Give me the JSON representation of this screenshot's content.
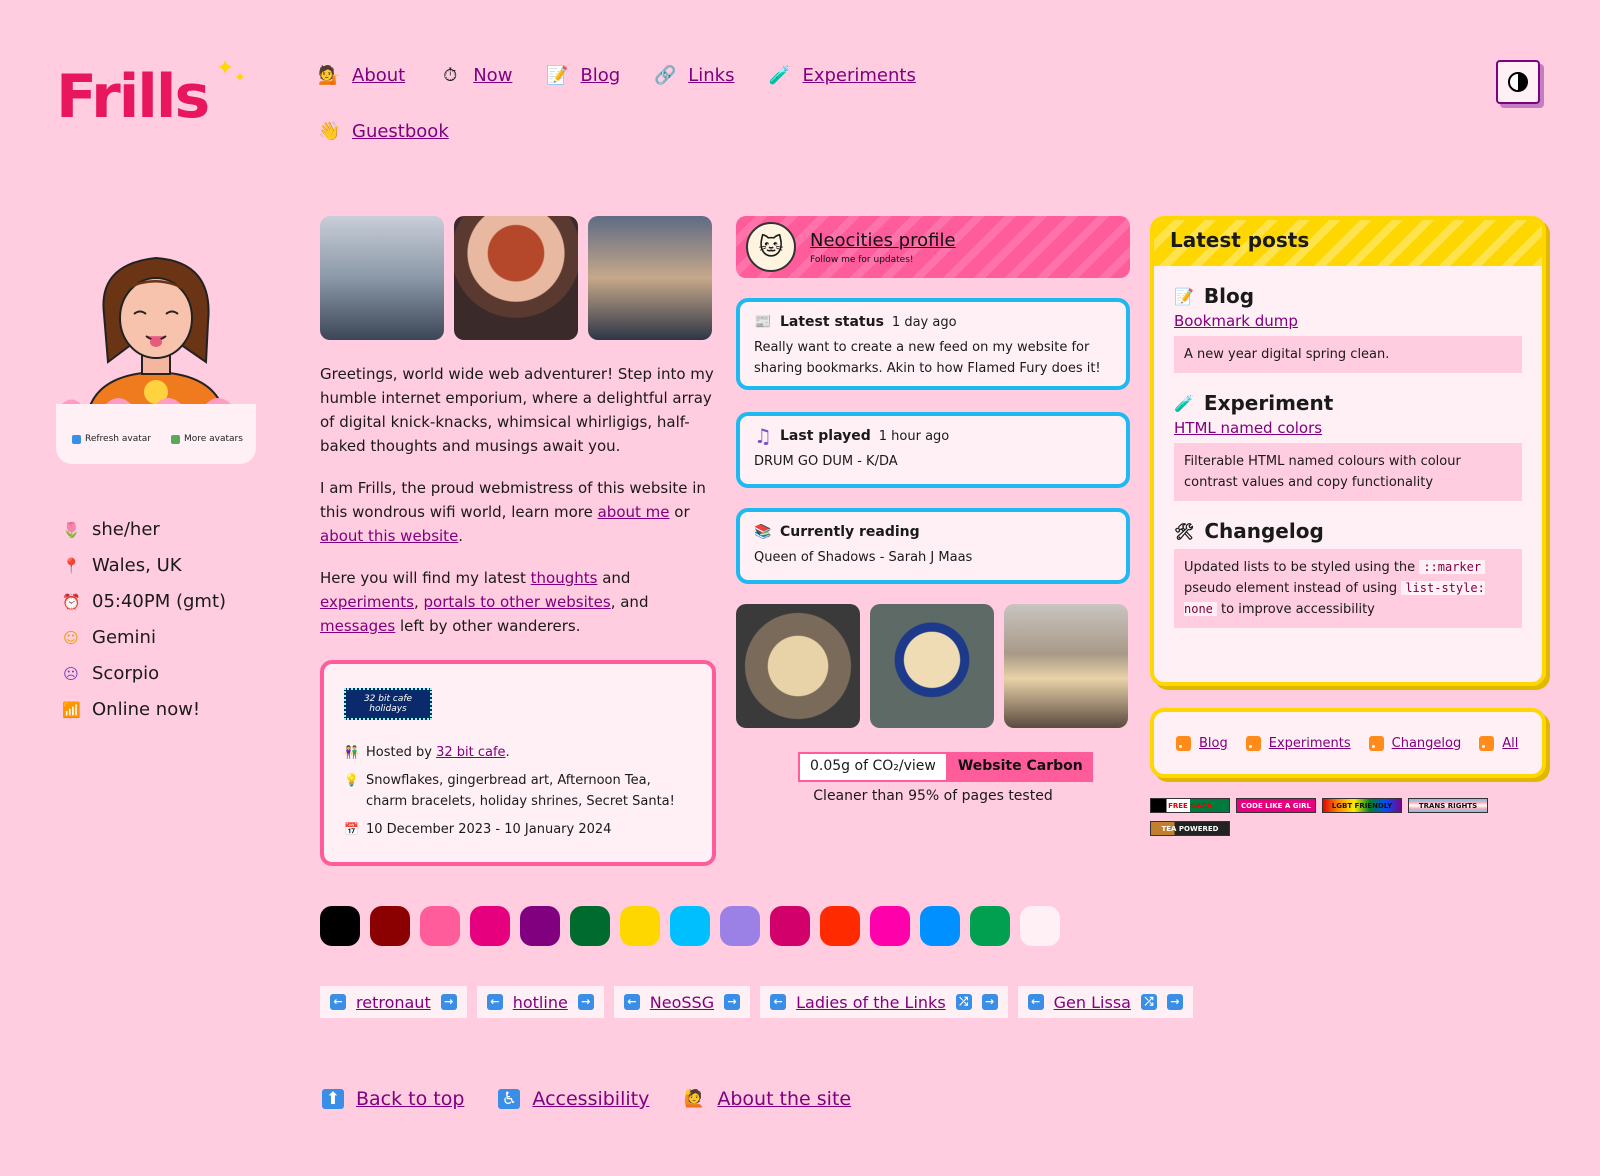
{
  "site": {
    "logo": "Frills"
  },
  "nav": [
    {
      "label": "About",
      "icon": "💁"
    },
    {
      "label": "Now",
      "icon": "⏱"
    },
    {
      "label": "Blog",
      "icon": "📝"
    },
    {
      "label": "Links",
      "icon": "🔗"
    },
    {
      "label": "Experiments",
      "icon": "🧪"
    },
    {
      "label": "Guestbook",
      "icon": "👋"
    }
  ],
  "avatar": {
    "refresh_label": "Refresh avatar",
    "more_label": "More avatars"
  },
  "facts": [
    {
      "icon": "🌷",
      "text": "she/her"
    },
    {
      "icon": "📍",
      "text": "Wales, UK"
    },
    {
      "icon": "⏰",
      "text": "05:40PM (gmt)"
    },
    {
      "icon": "☺",
      "text": "Gemini"
    },
    {
      "icon": "☹",
      "text": "Scorpio"
    },
    {
      "icon": "📶",
      "text": "Online now!"
    }
  ],
  "intro": {
    "p1": "Greetings, world wide web adventurer! Step into my humble internet emporium, where a delightful array of digital knick-knacks, whimsical whirligigs, half-baked thoughts and musings await you.",
    "p2_a": "I am Frills, the proud webmistress of this website in this wondrous wifi world, learn more ",
    "p2_link1": "about me",
    "p2_b": " or ",
    "p2_link2": "about this website",
    "p2_c": ".",
    "p3_a": "Here you will find my latest ",
    "p3_link1": "thoughts",
    "p3_b": " and ",
    "p3_link2": "experiments",
    "p3_c": ", ",
    "p3_link3": "portals to other websites",
    "p3_d": ", and ",
    "p3_link4": "messages",
    "p3_e": " left by other wanderers."
  },
  "event": {
    "badge": "32 bit cafe holidays",
    "hosted_prefix": "Hosted by ",
    "hosted_link": "32 bit cafe",
    "hosted_suffix": ".",
    "themes": "Snowflakes, gingerbread art, Afternoon Tea, charm bracelets, holiday shrines, Secret Santa!",
    "dates": "10 December 2023 - 10 January 2024"
  },
  "neocities": {
    "title": "Neocities profile",
    "subtitle": "Follow me for updates!"
  },
  "status": {
    "title": "Latest status",
    "ago": "1 day ago",
    "text": "Really want to create a new feed on my website for sharing bookmarks. Akin to how Flamed Fury does it!"
  },
  "played": {
    "title": "Last played",
    "ago": "1 hour ago",
    "text": "DRUM GO DUM - K/DA"
  },
  "reading": {
    "title": "Currently reading",
    "text": "Queen of Shadows - Sarah J Maas"
  },
  "carbon": {
    "value": "0.05g of CO₂/view",
    "label": "Website Carbon",
    "sub": "Cleaner than 95% of pages tested"
  },
  "posts": {
    "heading": "Latest posts",
    "blog": {
      "title": "Blog",
      "link": "Bookmark dump",
      "desc": "A new year digital spring clean."
    },
    "experiment": {
      "title": "Experiment",
      "link": "HTML named colors",
      "desc": "Filterable HTML named colours with colour contrast values and copy functionality"
    },
    "changelog": {
      "title": "Changelog",
      "a": "Updated lists to be styled using the ",
      "code1": "::marker",
      "b": " pseudo element instead of using ",
      "code2": "list-style: none",
      "c": " to improve accessibility"
    }
  },
  "feeds": [
    "Blog",
    "Experiments",
    "Changelog",
    "All"
  ],
  "buttons88": [
    "FREE GAZA",
    "CODE LIKE A GIRL",
    "LGBT FRIENDLY",
    "TRANS RIGHTS",
    "TEA POWERED"
  ],
  "swatches": [
    "#000000",
    "#8b0000",
    "#ff5c9c",
    "#e6007e",
    "#800080",
    "#006b2e",
    "#ffd700",
    "#00bfff",
    "#9b80e6",
    "#d1006b",
    "#ff2a00",
    "#ff00aa",
    "#0090ff",
    "#00a050",
    "#fff0f5"
  ],
  "webrings": [
    "retronaut",
    "hotline",
    "NeoSSG",
    "Ladies of the Links",
    "Gen Lissa"
  ],
  "footer": [
    {
      "label": "Back to top",
      "icon": "⬆"
    },
    {
      "label": "Accessibility",
      "icon": "♿"
    },
    {
      "label": "About the site",
      "icon": "🙋"
    }
  ]
}
